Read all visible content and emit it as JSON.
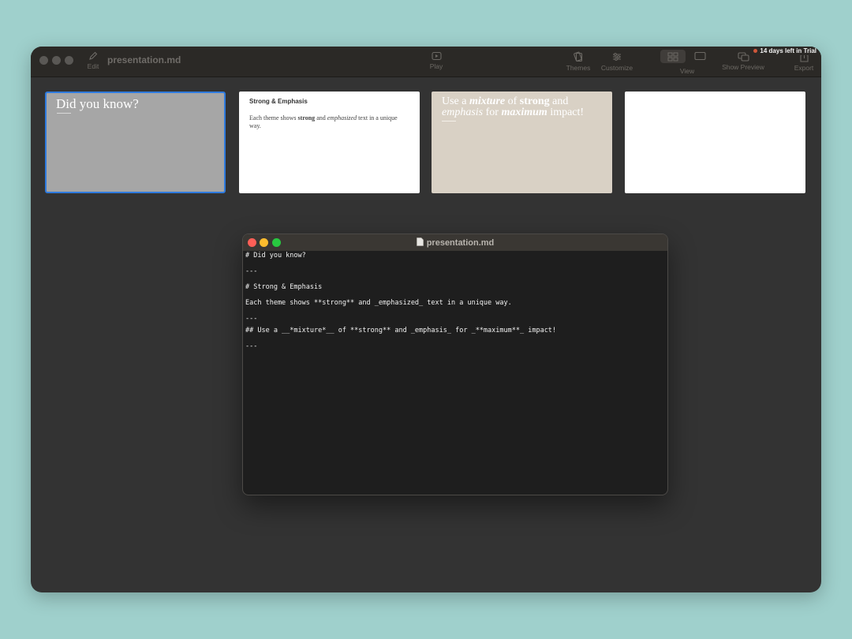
{
  "window": {
    "title": "presentation.md",
    "trial_text": "14 days left in Trial"
  },
  "toolbar": {
    "edit_label": "Edit",
    "play_label": "Play",
    "themes_label": "Themes",
    "customize_label": "Customize",
    "view_label": "View",
    "show_preview_label": "Show Preview",
    "export_label": "Export"
  },
  "slides": [
    {
      "title": "Did you know?",
      "background": "#a6a6a6",
      "selected": true
    },
    {
      "heading": "Strong & Emphasis",
      "p1": "Each theme shows ",
      "p_strong": "strong",
      "p2": " and ",
      "p_em": "emphasized",
      "p3": " text in a unique way.",
      "background": "#ffffff"
    },
    {
      "t1": "Use a ",
      "t_mixture": "mixture",
      "t2": " of ",
      "t_strong": "strong",
      "t3": " and ",
      "t_emphasis": "emphasis",
      "t4": " for ",
      "t_maximum": "maximum",
      "t5": " impact!",
      "background": "#d9d1c5"
    },
    {
      "background": "#ffffff"
    }
  ],
  "editor": {
    "title": "presentation.md",
    "lines": [
      "# Did you know?",
      "---",
      "# Strong & Emphasis",
      "Each theme shows **strong** and _emphasized_ text in a unique way.",
      "---",
      "## Use a __*mixture*__ of **strong** and _emphasis_ for _**maximum**_ impact!",
      "---"
    ]
  }
}
